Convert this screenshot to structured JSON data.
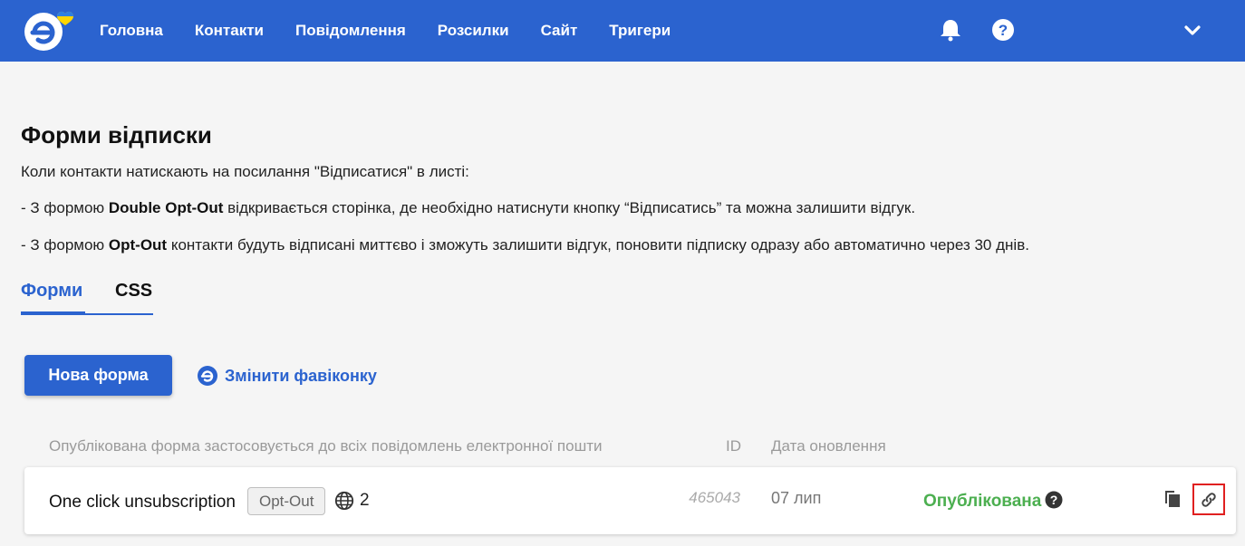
{
  "header": {
    "nav": [
      "Головна",
      "Контакти",
      "Повідомлення",
      "Розсилки",
      "Сайт",
      "Тригери"
    ],
    "icons": {
      "notifications": "bell-icon",
      "help": "question-circle-icon",
      "menu": "chevron-down-icon"
    },
    "brand_color": "#2b63cf"
  },
  "page": {
    "title": "Форми відписки",
    "intro": "Коли контакти натискають на посилання \"Відписатися\" в листі:",
    "line1": {
      "prefix": "- З формою ",
      "bold": "Double Opt-Out",
      "suffix": " відкривається сторінка, де необхідно натиснути кнопку “Відписатись” та можна залишити відгук."
    },
    "line2": {
      "prefix": "- З формою ",
      "bold": "Opt-Out",
      "suffix": " контакти будуть відписані миттєво і зможуть залишити відгук, поновити підписку одразу або автоматично через 30 днів."
    }
  },
  "tabs": [
    {
      "label": "Форми",
      "active": true
    },
    {
      "label": "CSS",
      "active": false
    }
  ],
  "actions": {
    "new_form": "Нова форма",
    "change_favicon": "Змінити фавіконку"
  },
  "table": {
    "headers": {
      "name": "Опублікована форма застосовується до всіх повідомлень електронної пошти",
      "id": "ID",
      "updated": "Дата оновлення"
    },
    "rows": [
      {
        "name": "One click unsubscription",
        "type": "Opt-Out",
        "languages": "2",
        "id": "465043",
        "updated": "07 лип",
        "status": "Опублікована",
        "status_color": "#4caf50"
      }
    ]
  }
}
